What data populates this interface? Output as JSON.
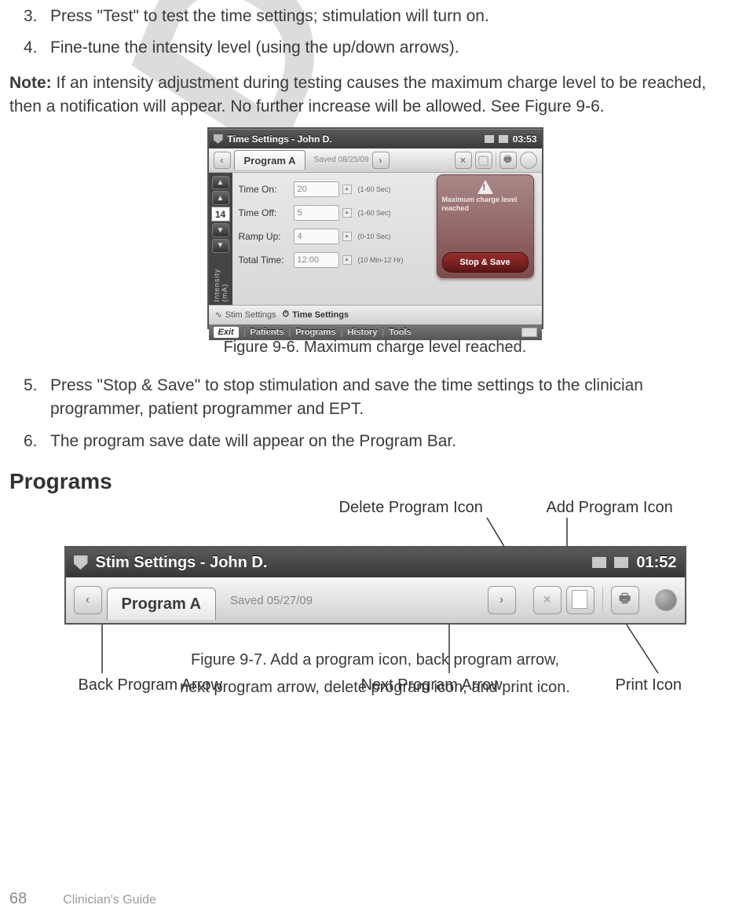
{
  "watermark": "DRAFT",
  "steps_a": [
    {
      "n": "3.",
      "t": "Press \"Test\" to test the time settings; stimulation will turn on."
    },
    {
      "n": "4.",
      "t": "Fine-tune the intensity level (using the up/down arrows)."
    }
  ],
  "note_bold": "Note:",
  "note_text": " If an intensity adjustment during testing causes the maximum charge level to be reached, then a notification will appear. No further increase will be allowed. See Figure 9-6.",
  "fig96": {
    "title": "Time Settings - John D.",
    "clock": "03:53",
    "program": "Program A",
    "saved": "Saved 08/25/09",
    "intensity_value": "14",
    "intensity_label": "Intensity (mA)",
    "rows": [
      {
        "lbl": "Time On:",
        "val": "20",
        "hint": "(1-60 Sec)"
      },
      {
        "lbl": "Time Off:",
        "val": "5",
        "hint": "(1-60 Sec)"
      },
      {
        "lbl": "Ramp Up:",
        "val": "4",
        "hint": "(0-10 Sec)"
      },
      {
        "lbl": "Total Time:",
        "val": "12:00",
        "hint": "(10 Min-12 Hr)"
      }
    ],
    "warn_text": "Maximum charge level reached",
    "warn_button": "Stop & Save",
    "tab1": "Stim Settings",
    "tab2": "Time Settings",
    "bottom": {
      "exit": "Exit",
      "m1": "Patients",
      "m2": "Programs",
      "m3": "History",
      "m4": "Tools"
    },
    "caption": "Figure 9-6. Maximum charge level reached."
  },
  "steps_b": [
    {
      "n": "5.",
      "t": "Press \"Stop & Save\" to stop stimulation and save the time settings to the clinician programmer, patient programmer and EPT."
    },
    {
      "n": "6.",
      "t": "The program save date will appear on the Program Bar."
    }
  ],
  "h_programs": "Programs",
  "fig97": {
    "title": "Stim Settings - John D.",
    "clock": "01:52",
    "program": "Program A",
    "saved": "Saved 05/27/09",
    "labels": {
      "delete": "Delete Program Icon",
      "add": "Add Program Icon",
      "back": "Back Program Arrow",
      "next": "Next Program Arrow",
      "print": "Print Icon"
    },
    "caption1": "Figure 9-7. Add a program icon, back program arrow,",
    "caption2": "next program arrow, delete program icon, and print icon."
  },
  "footer": {
    "page": "68",
    "guide": "Clinician's Guide"
  }
}
